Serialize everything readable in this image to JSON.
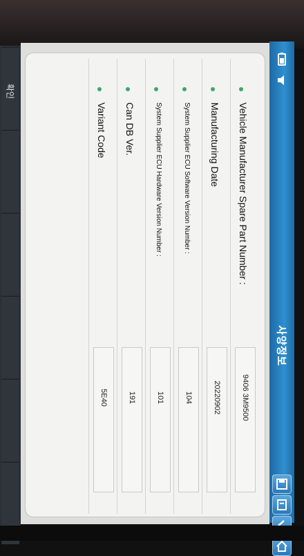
{
  "screen": {
    "title": "사양정보",
    "side_button_label": "확인",
    "rows": [
      {
        "label": "Vehicle Manufacturer Spare Part Number :",
        "value": "9406 3M9500",
        "small": false
      },
      {
        "label": "Manufacturing Date",
        "value": "20220902",
        "small": false
      },
      {
        "label": "System Supplier ECU Software Version Number :",
        "value": "104",
        "small": true
      },
      {
        "label": "System Supplier ECU Hardware Version Number :",
        "value": "101",
        "small": true
      },
      {
        "label": "Can DB Ver.",
        "value": "191",
        "small": false
      },
      {
        "label": "Variant Code",
        "value": "5E40",
        "small": false
      }
    ]
  },
  "colors": {
    "title_bar": "#2f8fd0",
    "bullet": "#3da86a"
  },
  "icons": [
    "home-icon",
    "back-icon",
    "print-icon",
    "save-icon",
    "battery-icon",
    "speaker-icon"
  ]
}
